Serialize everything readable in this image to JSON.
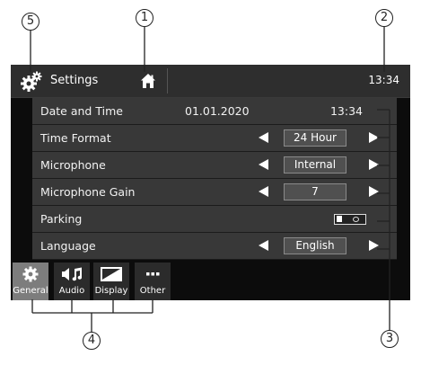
{
  "callouts": {
    "c1": "1",
    "c2": "2",
    "c3": "3",
    "c4": "4",
    "c5": "5"
  },
  "header": {
    "title": "Settings",
    "time": "13:34",
    "settings_icon": "gear-icon",
    "home_icon": "home-icon"
  },
  "rows": [
    {
      "label": "Date and Time",
      "value1": "01.01.2020",
      "value2": "13:34"
    },
    {
      "label": "Time Format",
      "value": "24 Hour"
    },
    {
      "label": "Microphone",
      "value": "Internal"
    },
    {
      "label": "Microphone Gain",
      "value": "7"
    },
    {
      "label": "Parking"
    },
    {
      "label": "Language",
      "value": "English"
    }
  ],
  "tabs": [
    {
      "label": "General",
      "icon": "gear-icon"
    },
    {
      "label": "Audio",
      "icon": "audio-icon"
    },
    {
      "label": "Display",
      "icon": "display-icon"
    },
    {
      "label": "Other",
      "icon": "more-icon"
    }
  ],
  "colors": {
    "background": "#0c0c0c",
    "row": "#383838",
    "active_tab": "#7d7d7d",
    "text": "#ffffff"
  }
}
